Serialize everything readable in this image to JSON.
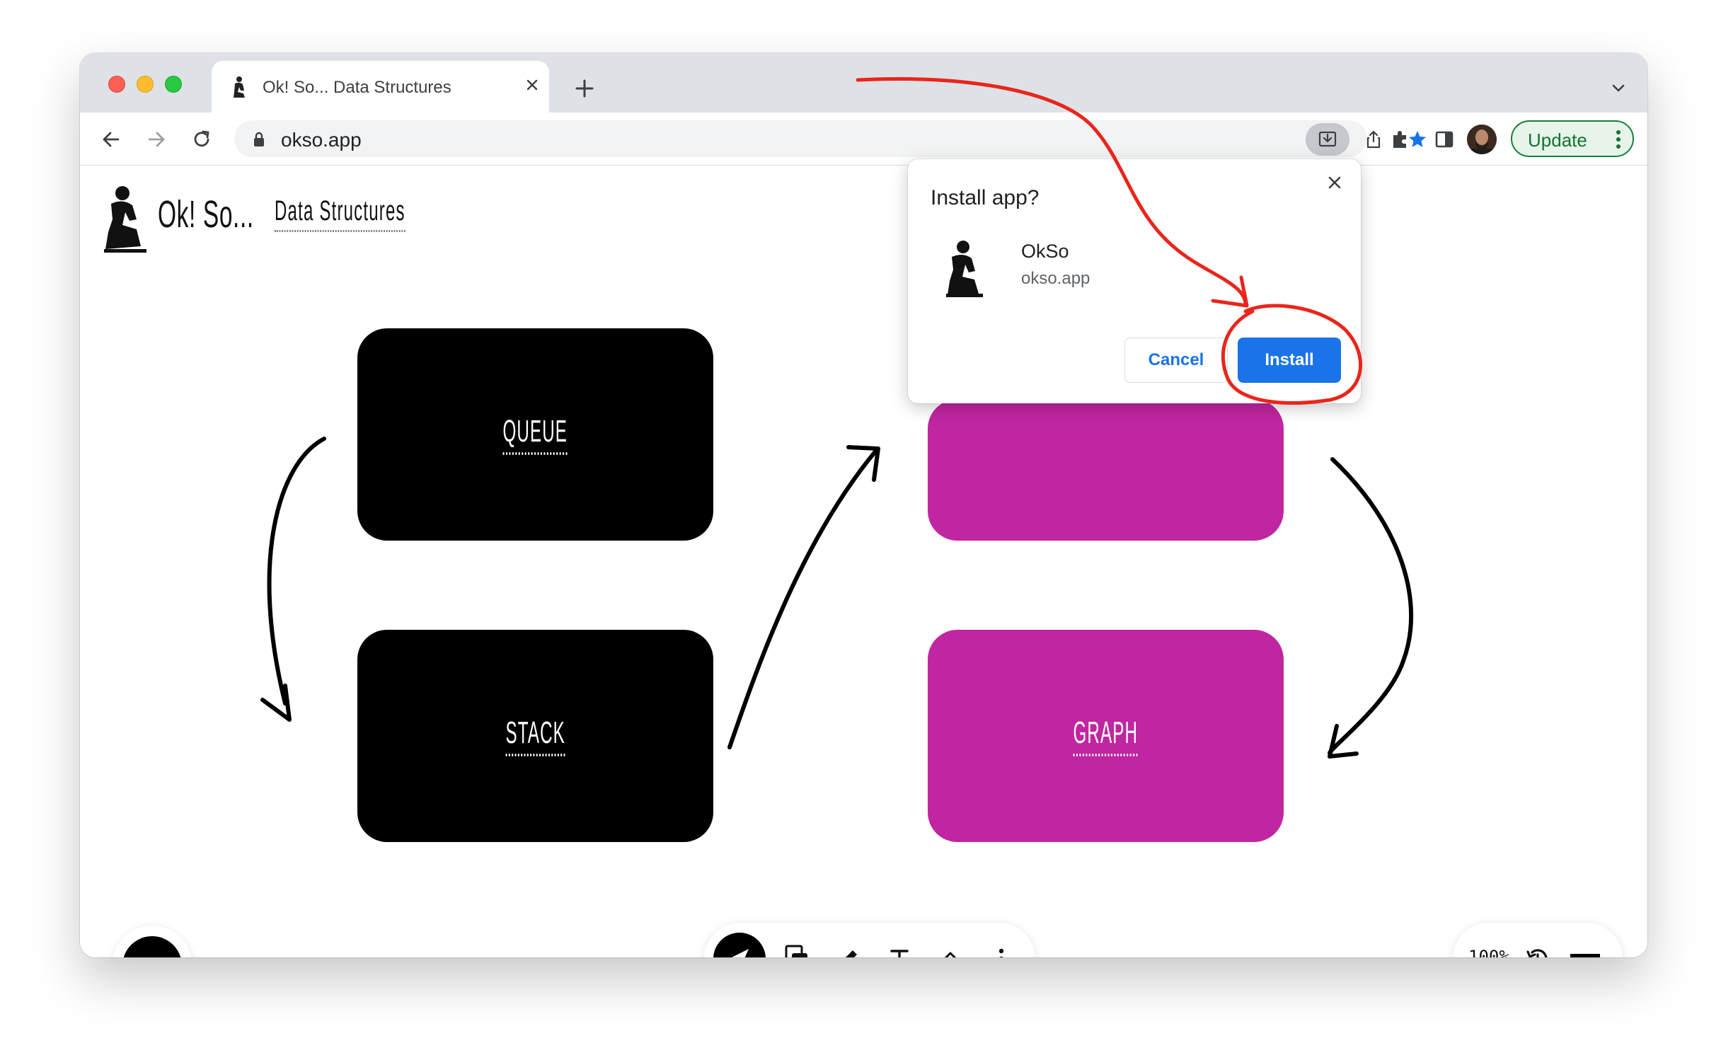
{
  "browser": {
    "tab_title": "Ok! So... Data Structures",
    "url": "okso.app",
    "update_label": "Update"
  },
  "app": {
    "brand": "Ok! So...",
    "breadcrumb": "Data Structures",
    "cards": [
      {
        "label": "Queue",
        "color": "#000000"
      },
      {
        "label": "Stack",
        "color": "#000000"
      },
      {
        "label": "Graph",
        "color": "#c026a1"
      }
    ],
    "zoom": "100%"
  },
  "dialog": {
    "title": "Install app?",
    "app_name": "OkSo",
    "origin": "okso.app",
    "cancel_label": "Cancel",
    "install_label": "Install"
  },
  "colors": {
    "accent": "#1a73e8",
    "magenta": "#c026a1",
    "annotation": "#e8261c"
  }
}
